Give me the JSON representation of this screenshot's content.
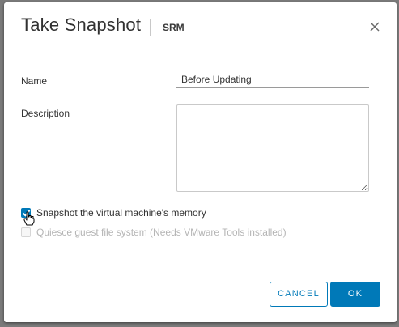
{
  "dialog": {
    "title": "Take Snapshot",
    "subtitle": "SRM",
    "close_icon": "close-icon"
  },
  "form": {
    "name_label": "Name",
    "name_value": "Before Updating",
    "description_label": "Description",
    "description_value": ""
  },
  "options": {
    "memory_label": "Snapshot the virtual machine's memory",
    "memory_checked": true,
    "quiesce_label": "Quiesce guest file system (Needs VMware Tools installed)",
    "quiesce_checked": false,
    "quiesce_disabled": true
  },
  "buttons": {
    "cancel_label": "CANCEL",
    "ok_label": "OK"
  },
  "colors": {
    "accent": "#0079b8",
    "disabled_text": "#b5b5b5",
    "title_text": "#313131"
  }
}
